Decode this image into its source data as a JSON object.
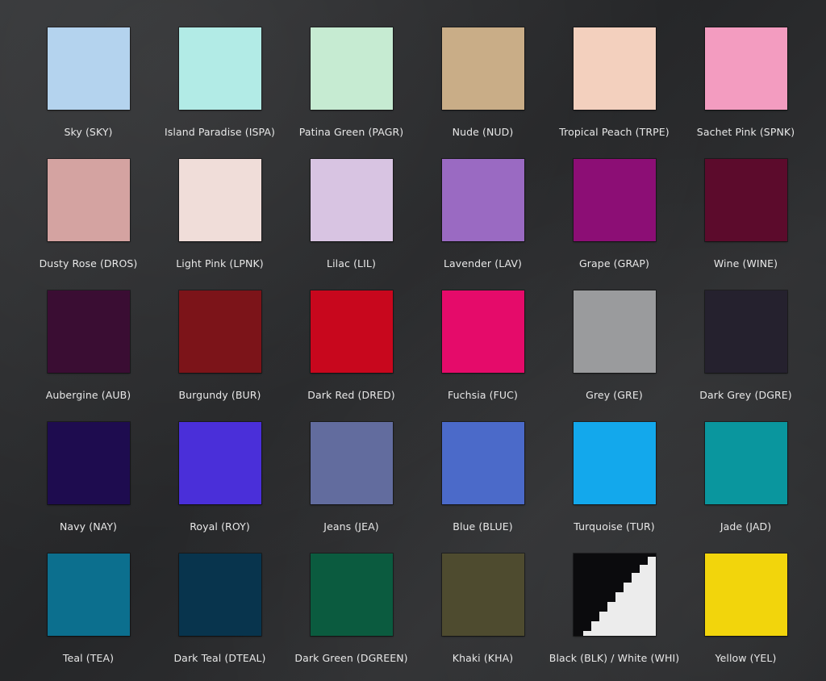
{
  "swatches": [
    {
      "name": "Sky (SKY)",
      "color": "#b4d3ee"
    },
    {
      "name": "Island Paradise (ISPA)",
      "color": "#b2ebe6"
    },
    {
      "name": "Patina Green (PAGR)",
      "color": "#c6ebd2"
    },
    {
      "name": "Nude (NUD)",
      "color": "#c9ad87"
    },
    {
      "name": "Tropical Peach (TRPE)",
      "color": "#f3d0be"
    },
    {
      "name": "Sachet Pink (SPNK)",
      "color": "#f39cc0"
    },
    {
      "name": "Dusty Rose (DROS)",
      "color": "#d4a3a1"
    },
    {
      "name": "Light Pink (LPNK)",
      "color": "#f0ddd9"
    },
    {
      "name": "Lilac (LIL)",
      "color": "#d8c4e2"
    },
    {
      "name": "Lavender (LAV)",
      "color": "#9a6ac2"
    },
    {
      "name": "Grape (GRAP)",
      "color": "#8c0e75"
    },
    {
      "name": "Wine (WINE)",
      "color": "#5c0b2c"
    },
    {
      "name": "Aubergine (AUB)",
      "color": "#3a0d33"
    },
    {
      "name": "Burgundy (BUR)",
      "color": "#7c1419"
    },
    {
      "name": "Dark Red (DRED)",
      "color": "#c8071d"
    },
    {
      "name": "Fuchsia (FUC)",
      "color": "#e50b6a"
    },
    {
      "name": "Grey (GRE)",
      "color": "#9a9b9d"
    },
    {
      "name": "Dark Grey (DGRE)",
      "color": "#25212e"
    },
    {
      "name": "Navy (NAY)",
      "color": "#1e0c4f"
    },
    {
      "name": "Royal (ROY)",
      "color": "#4a2fd9"
    },
    {
      "name": "Jeans (JEA)",
      "color": "#626c9e"
    },
    {
      "name": "Blue (BLUE)",
      "color": "#4b6ac9"
    },
    {
      "name": "Turquoise (TUR)",
      "color": "#13a8ec"
    },
    {
      "name": "Jade (JAD)",
      "color": "#0a969e"
    },
    {
      "name": "Teal (TEA)",
      "color": "#0c6f8e"
    },
    {
      "name": "Dark Teal (DTEAL)",
      "color": "#08344d"
    },
    {
      "name": "Dark Green (DGREEN)",
      "color": "#0b5b3f"
    },
    {
      "name": "Khaki (KHA)",
      "color": "#4e4b2f"
    },
    {
      "name": "Black (BLK) / White (WHI)",
      "color": "#0b0b0d",
      "secondary_color": "#ececec"
    },
    {
      "name": "Yellow (YEL)",
      "color": "#f2d50c"
    }
  ]
}
